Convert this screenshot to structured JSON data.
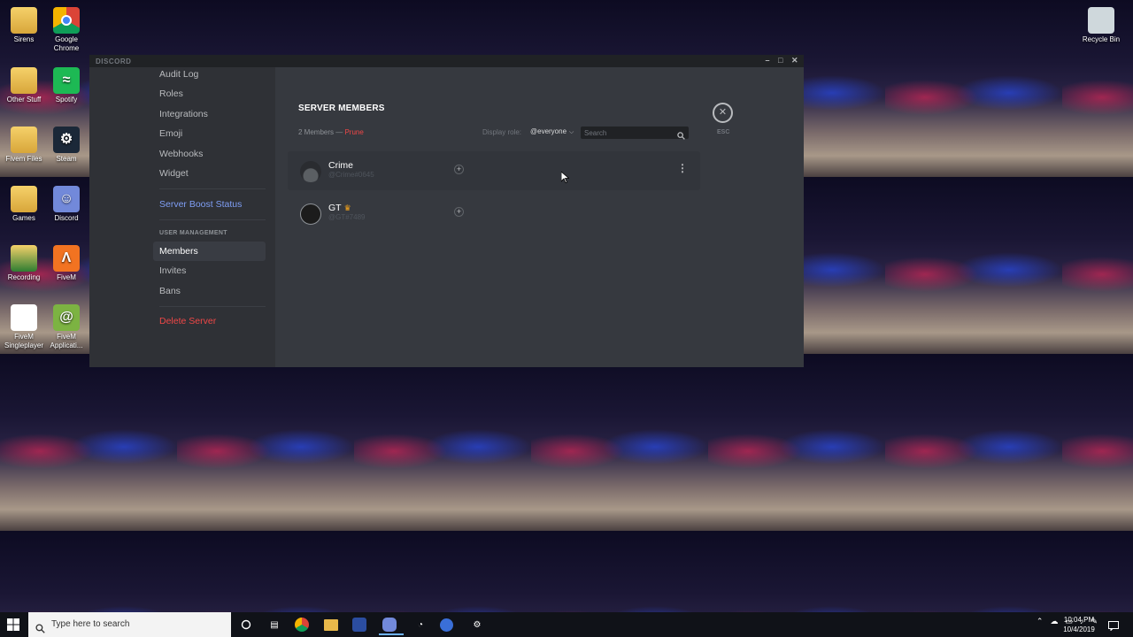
{
  "desktop": {
    "icons": [
      {
        "label": "Sirens",
        "icon": "folder-icon"
      },
      {
        "label": "Google Chrome",
        "icon": "chrome-icon"
      },
      {
        "label": "Other Stuff",
        "icon": "folder-icon"
      },
      {
        "label": "Spotify",
        "icon": "spotify-icon"
      },
      {
        "label": "Fivem Files",
        "icon": "folder-icon"
      },
      {
        "label": "Steam",
        "icon": "steam-icon"
      },
      {
        "label": "Games",
        "icon": "folder-icon"
      },
      {
        "label": "Discord",
        "icon": "discord-icon"
      },
      {
        "label": "Recording",
        "icon": "folder-icon"
      },
      {
        "label": "FiveM",
        "icon": "fivem-icon"
      },
      {
        "label": "FiveM Singleplayer",
        "icon": "document-icon"
      },
      {
        "label": "FiveM Applicati...",
        "icon": "snail-icon"
      },
      {
        "label": "Recycle Bin",
        "icon": "recycle-bin-icon"
      }
    ]
  },
  "window": {
    "brand": "DISCORD",
    "controls": [
      "–",
      "□",
      "✕"
    ]
  },
  "sidebar": {
    "items_top": [
      "Audit Log",
      "Roles",
      "Integrations",
      "Emoji",
      "Webhooks",
      "Widget"
    ],
    "boost": "Server Boost Status",
    "section_header": "USER MANAGEMENT",
    "items_user": [
      "Members",
      "Invites",
      "Bans"
    ],
    "active_item": "Members",
    "delete": "Delete Server"
  },
  "main": {
    "title": "SERVER MEMBERS",
    "count": "2 Members —",
    "prune": "Prune",
    "display_role_label": "Display role:",
    "display_role_value": "@everyone",
    "search_placeholder": "Search",
    "close_label": "ESC",
    "members": [
      {
        "name": "Crime",
        "tag": "@Crime#0645",
        "owner": false
      },
      {
        "name": "GT",
        "tag": "@GT#7489",
        "owner": true
      }
    ]
  },
  "taskbar": {
    "search_placeholder": "Type here to search",
    "time": "10:04 PM",
    "date": "10/4/2019"
  },
  "colors": {
    "discord_bg": "#36393f",
    "discord_sidebar": "#2f3136",
    "titlebar": "#202225",
    "danger": "#f04747",
    "boost": "#7f9ef5",
    "owner_crown": "#faa61a"
  }
}
